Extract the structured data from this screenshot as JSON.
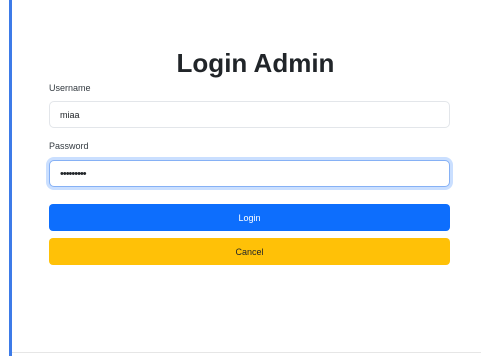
{
  "login": {
    "title": "Login Admin",
    "username_label": "Username",
    "username_value": "miaa",
    "password_label": "Password",
    "password_value": "•••••••••",
    "login_button": "Login",
    "cancel_button": "Cancel"
  },
  "colors": {
    "accent": "#3d7be8",
    "primary": "#0d6efd",
    "warning": "#ffc107"
  }
}
